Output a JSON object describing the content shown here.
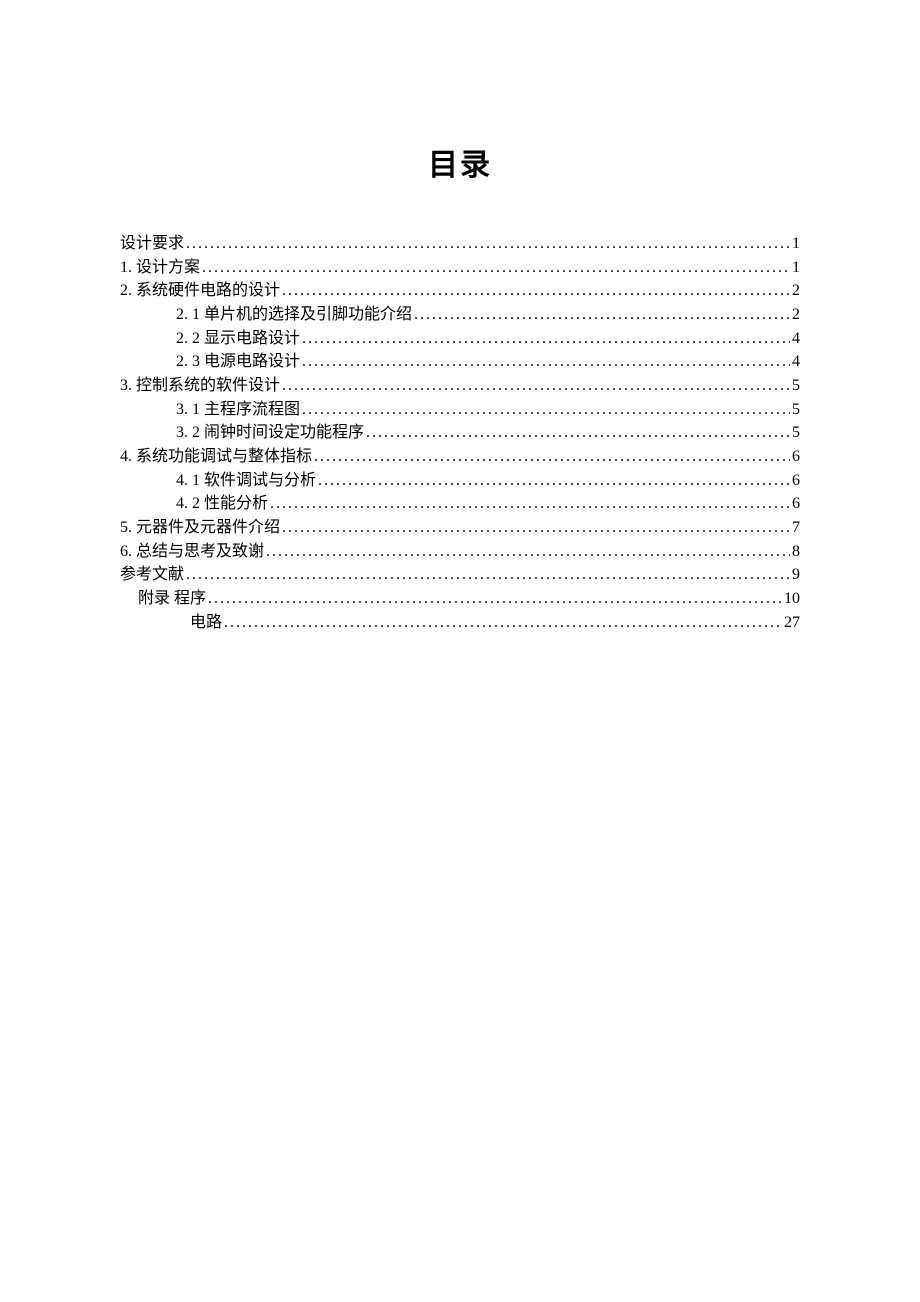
{
  "title": "目录",
  "entries": [
    {
      "label": "设计要求 ",
      "page": "1",
      "indent": 0
    },
    {
      "label": "1.  设计方案 ",
      "page": "1",
      "indent": 0
    },
    {
      "label": "2.  系统硬件电路的设计 ",
      "page": "2",
      "indent": 0
    },
    {
      "label": "2. 1 单片机的选择及引脚功能介绍",
      "page": "2",
      "indent": 1
    },
    {
      "label": "2. 2 显示电路设计",
      "page": "4",
      "indent": 1
    },
    {
      "label": "2. 3 电源电路设计",
      "page": "4",
      "indent": 1
    },
    {
      "label": "3.  控制系统的软件设计 ",
      "page": "5",
      "indent": 0
    },
    {
      "label": "3. 1 主程序流程图",
      "page": "5",
      "indent": 1
    },
    {
      "label": "3. 2 闹钟时间设定功能程序",
      "page": "5",
      "indent": 1
    },
    {
      "label": "4.  系统功能调试与整体指标 ",
      "page": "6",
      "indent": 0
    },
    {
      "label": "4. 1 软件调试与分析",
      "page": "6",
      "indent": 1
    },
    {
      "label": "4. 2 性能分析",
      "page": "6",
      "indent": 1
    },
    {
      "label": "5.  元器件及元器件介绍 ",
      "page": "7",
      "indent": 0
    },
    {
      "label": "6.  总结与思考及致谢 ",
      "page": "8",
      "indent": 0
    },
    {
      "label": "参考文献 ",
      "page": "9",
      "indent": 0
    },
    {
      "label": "附录    程序 ",
      "page": "10",
      "indent": 0,
      "appendix": true,
      "appindent": 18
    },
    {
      "label": "电路 ",
      "page": "27",
      "indent": 1,
      "appindent": 70
    }
  ]
}
